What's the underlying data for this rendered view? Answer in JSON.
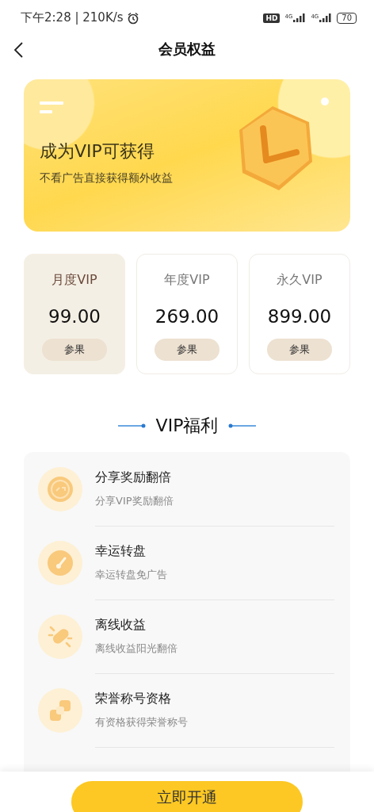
{
  "status_bar": {
    "time": "下午2:28 | 210K/s",
    "hd": "HD",
    "networks": [
      "4G",
      "4G"
    ],
    "battery": "70"
  },
  "nav": {
    "title": "会员权益"
  },
  "banner": {
    "title": "成为VIP可获得",
    "subtitle": "不看广告直接获得额外收益"
  },
  "plans": [
    {
      "name": "月度VIP",
      "price": "99.00",
      "button": "参果",
      "selected": true
    },
    {
      "name": "年度VIP",
      "price": "269.00",
      "button": "参果",
      "selected": false
    },
    {
      "name": "永久VIP",
      "price": "899.00",
      "button": "参果",
      "selected": false
    }
  ],
  "section_title": "VIP福利",
  "benefits": [
    {
      "kind": "share",
      "title": "分享奖励翻倍",
      "subtitle": "分享VIP奖励翻倍"
    },
    {
      "kind": "wheel",
      "title": "幸运转盘",
      "subtitle": "幸运转盘免广告"
    },
    {
      "kind": "offline",
      "title": "离线收益",
      "subtitle": "离线收益阳光翻倍"
    },
    {
      "kind": "honor",
      "title": "荣誉称号资格",
      "subtitle": "有资格获得荣誉称号"
    }
  ],
  "action_button": "立即开通"
}
